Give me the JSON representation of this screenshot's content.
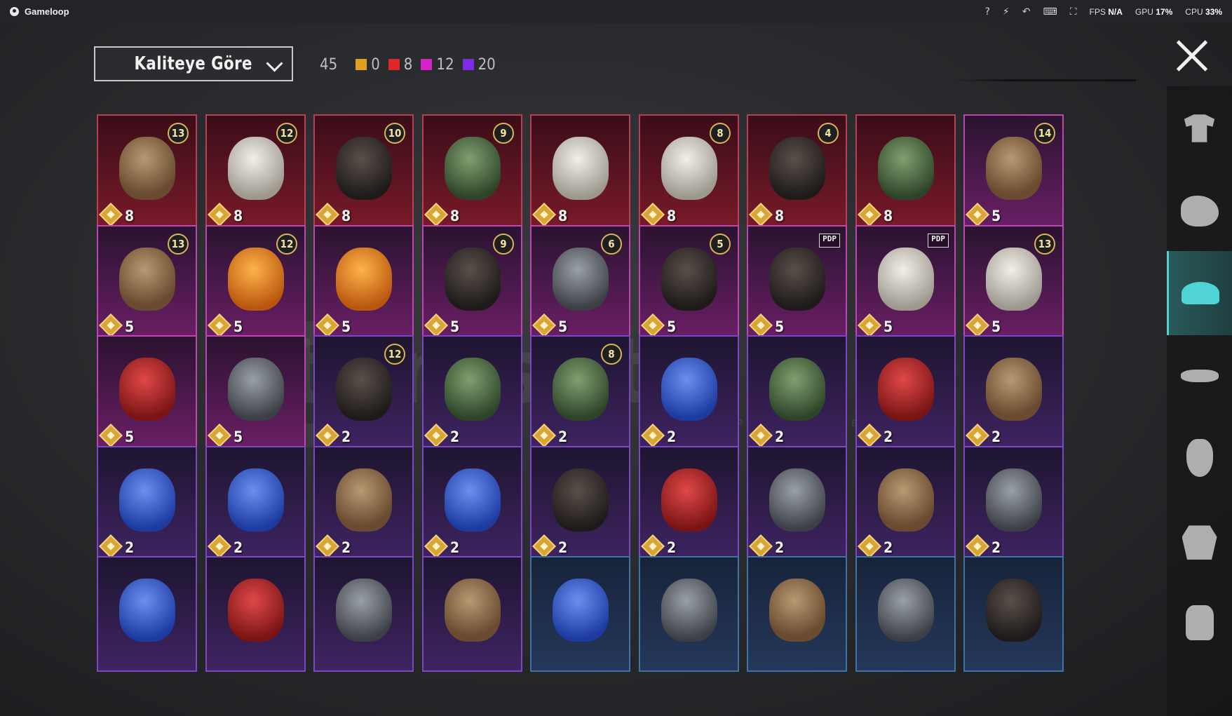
{
  "titlebar": {
    "app_name": "Gameloop",
    "fps_label": "FPS",
    "fps_value": "N/A",
    "gpu_label": "GPU",
    "gpu_value": "17%",
    "cpu_label": "CPU",
    "cpu_value": "33%",
    "icons": [
      "help-icon",
      "boost-icon",
      "undo-icon",
      "keyboard-icon",
      "fullscreen-icon"
    ]
  },
  "toolbar": {
    "sort_label": "Kaliteye Göre",
    "total_count": "45",
    "quality_counts": [
      {
        "color": "#e0a020",
        "value": "0"
      },
      {
        "color": "#e02828",
        "value": "8"
      },
      {
        "color": "#d424c8",
        "value": "12"
      },
      {
        "color": "#7a2ee0",
        "value": "20"
      }
    ]
  },
  "watermark": {
    "brand": "itemsatis",
    "tagline": "HESAP / SKIN / ITEM / E-PIN",
    "suffix": ".com"
  },
  "items": [
    {
      "quality": "red",
      "price": "8",
      "level": "13",
      "art": "hair"
    },
    {
      "quality": "red",
      "price": "8",
      "level": "12",
      "art": "white"
    },
    {
      "quality": "red",
      "price": "8",
      "level": "10",
      "art": "dark"
    },
    {
      "quality": "red",
      "price": "8",
      "level": "9",
      "art": "green"
    },
    {
      "quality": "red",
      "price": "8",
      "level": "",
      "art": "white"
    },
    {
      "quality": "red",
      "price": "8",
      "level": "8",
      "art": "white"
    },
    {
      "quality": "red",
      "price": "8",
      "level": "4",
      "art": "dark"
    },
    {
      "quality": "red",
      "price": "8",
      "level": "",
      "art": "green"
    },
    {
      "quality": "pink",
      "price": "5",
      "level": "14",
      "art": "hair"
    },
    {
      "quality": "pink",
      "price": "5",
      "level": "13",
      "art": "hair"
    },
    {
      "quality": "pink",
      "price": "5",
      "level": "12",
      "art": "orange"
    },
    {
      "quality": "pink",
      "price": "5",
      "level": "",
      "art": "orange"
    },
    {
      "quality": "pink",
      "price": "5",
      "level": "9",
      "art": "dark"
    },
    {
      "quality": "pink",
      "price": "5",
      "level": "6",
      "art": "grey"
    },
    {
      "quality": "pink",
      "price": "5",
      "level": "5",
      "art": "dark"
    },
    {
      "quality": "pink",
      "price": "5",
      "tag": "PDP",
      "art": "dark"
    },
    {
      "quality": "pink",
      "price": "5",
      "tag": "PDP",
      "art": "white"
    },
    {
      "quality": "pink",
      "price": "5",
      "level": "13",
      "art": "white"
    },
    {
      "quality": "pink",
      "price": "5",
      "level": "",
      "art": "red"
    },
    {
      "quality": "pink",
      "price": "5",
      "level": "",
      "art": "grey"
    },
    {
      "quality": "purple",
      "price": "2",
      "level": "12",
      "art": "dark"
    },
    {
      "quality": "purple",
      "price": "2",
      "level": "",
      "art": "green"
    },
    {
      "quality": "purple",
      "price": "2",
      "level": "8",
      "art": "green"
    },
    {
      "quality": "purple",
      "price": "2",
      "level": "",
      "art": "blue"
    },
    {
      "quality": "purple",
      "price": "2",
      "level": "",
      "art": "green"
    },
    {
      "quality": "purple",
      "price": "2",
      "level": "",
      "art": "red"
    },
    {
      "quality": "purple",
      "price": "2",
      "level": "",
      "art": "hair"
    },
    {
      "quality": "purple",
      "price": "2",
      "level": "",
      "art": "blue"
    },
    {
      "quality": "purple",
      "price": "2",
      "level": "",
      "art": "blue"
    },
    {
      "quality": "purple",
      "price": "2",
      "level": "",
      "art": "hair"
    },
    {
      "quality": "purple",
      "price": "2",
      "level": "",
      "art": "blue"
    },
    {
      "quality": "purple",
      "price": "2",
      "level": "",
      "art": "dark"
    },
    {
      "quality": "purple",
      "price": "2",
      "level": "",
      "art": "red"
    },
    {
      "quality": "purple",
      "price": "2",
      "level": "",
      "art": "grey"
    },
    {
      "quality": "purple",
      "price": "2",
      "level": "",
      "art": "hair"
    },
    {
      "quality": "purple",
      "price": "2",
      "level": "",
      "art": "grey"
    },
    {
      "quality": "purple",
      "price": "",
      "level": "",
      "art": "blue"
    },
    {
      "quality": "purple",
      "price": "",
      "level": "",
      "art": "red"
    },
    {
      "quality": "purple",
      "price": "",
      "level": "",
      "art": "grey"
    },
    {
      "quality": "purple",
      "price": "",
      "level": "",
      "art": "hair"
    },
    {
      "quality": "blue",
      "price": "",
      "level": "",
      "art": "blue"
    },
    {
      "quality": "blue",
      "price": "",
      "level": "",
      "art": "grey"
    },
    {
      "quality": "blue",
      "price": "",
      "level": "",
      "art": "hair"
    },
    {
      "quality": "blue",
      "price": "",
      "level": "",
      "art": "grey"
    },
    {
      "quality": "blue",
      "price": "",
      "level": "",
      "art": "dark"
    }
  ],
  "sidebar": {
    "categories": [
      {
        "name": "outfit",
        "icon": "outfit-icon",
        "active": false
      },
      {
        "name": "emote",
        "icon": "fist-icon",
        "active": false
      },
      {
        "name": "hat",
        "icon": "cap-icon",
        "active": true
      },
      {
        "name": "glasses",
        "icon": "glasses-icon",
        "active": false
      },
      {
        "name": "mask",
        "icon": "mask-icon",
        "active": false
      },
      {
        "name": "jacket",
        "icon": "jacket-icon",
        "active": false
      },
      {
        "name": "backpack",
        "icon": "backpack-icon",
        "active": false
      }
    ]
  }
}
